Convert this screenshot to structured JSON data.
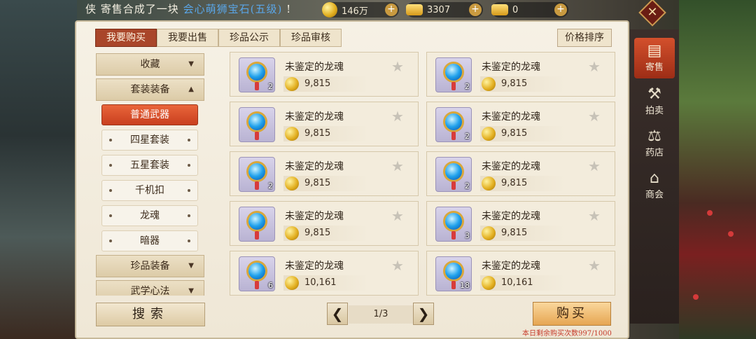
{
  "top": {
    "marquee_prefix": "侠",
    "marquee_main": "寄售合成了一块",
    "marquee_item": "会心萌狮宝石(五级)",
    "marquee_suffix": "!",
    "currency": [
      {
        "icon": "gold-coin-icon",
        "value": "146万"
      },
      {
        "icon": "gold-ingot-icon",
        "value": "3307"
      },
      {
        "icon": "silver-ingot-icon",
        "value": "0"
      }
    ],
    "plus": "+",
    "close": "✕"
  },
  "tabs": [
    "我要购买",
    "我要出售",
    "珍品公示",
    "珍品审核"
  ],
  "sort_label": "价格排序",
  "sidebar": {
    "collapsed_top": {
      "label": "收藏",
      "arrow": "▼"
    },
    "expanded": {
      "label": "套装装备",
      "arrow": "▲"
    },
    "subs": [
      "普通武器",
      "四星套装",
      "五星套装",
      "千机扣",
      "龙魂",
      "暗器"
    ],
    "bottom": [
      {
        "label": "珍品装备",
        "arrow": "▼"
      },
      {
        "label": "武学心法",
        "arrow": "▼"
      }
    ]
  },
  "search_label": "搜索",
  "items": [
    {
      "name": "未鉴定的龙魂",
      "price": "9,815",
      "qty": "2"
    },
    {
      "name": "未鉴定的龙魂",
      "price": "9,815",
      "qty": "2"
    },
    {
      "name": "未鉴定的龙魂",
      "price": "9,815",
      "qty": ""
    },
    {
      "name": "未鉴定的龙魂",
      "price": "9,815",
      "qty": "2"
    },
    {
      "name": "未鉴定的龙魂",
      "price": "9,815",
      "qty": "2"
    },
    {
      "name": "未鉴定的龙魂",
      "price": "9,815",
      "qty": "2"
    },
    {
      "name": "未鉴定的龙魂",
      "price": "9,815",
      "qty": ""
    },
    {
      "name": "未鉴定的龙魂",
      "price": "9,815",
      "qty": "3"
    },
    {
      "name": "未鉴定的龙魂",
      "price": "10,161",
      "qty": "6"
    },
    {
      "name": "未鉴定的龙魂",
      "price": "10,161",
      "qty": "18"
    }
  ],
  "star": "★",
  "pagination": {
    "prev": "❮",
    "label": "1/3",
    "next": "❯"
  },
  "buy_label": "购买",
  "buy_note": "本日剩余购买次数997/1000",
  "rnav": [
    {
      "icon": "consign-icon",
      "glyph": "▤",
      "label": "寄售"
    },
    {
      "icon": "auction-hammer-icon",
      "glyph": "⚒",
      "label": "拍卖"
    },
    {
      "icon": "scale-icon",
      "glyph": "⚖",
      "label": "药店"
    },
    {
      "icon": "shop-icon",
      "glyph": "⌂",
      "label": "商会"
    }
  ],
  "colors": {
    "accent": "#a9462a",
    "active_sub": "#e9653b",
    "buy": "#e6a652",
    "note": "#c63a2a"
  }
}
